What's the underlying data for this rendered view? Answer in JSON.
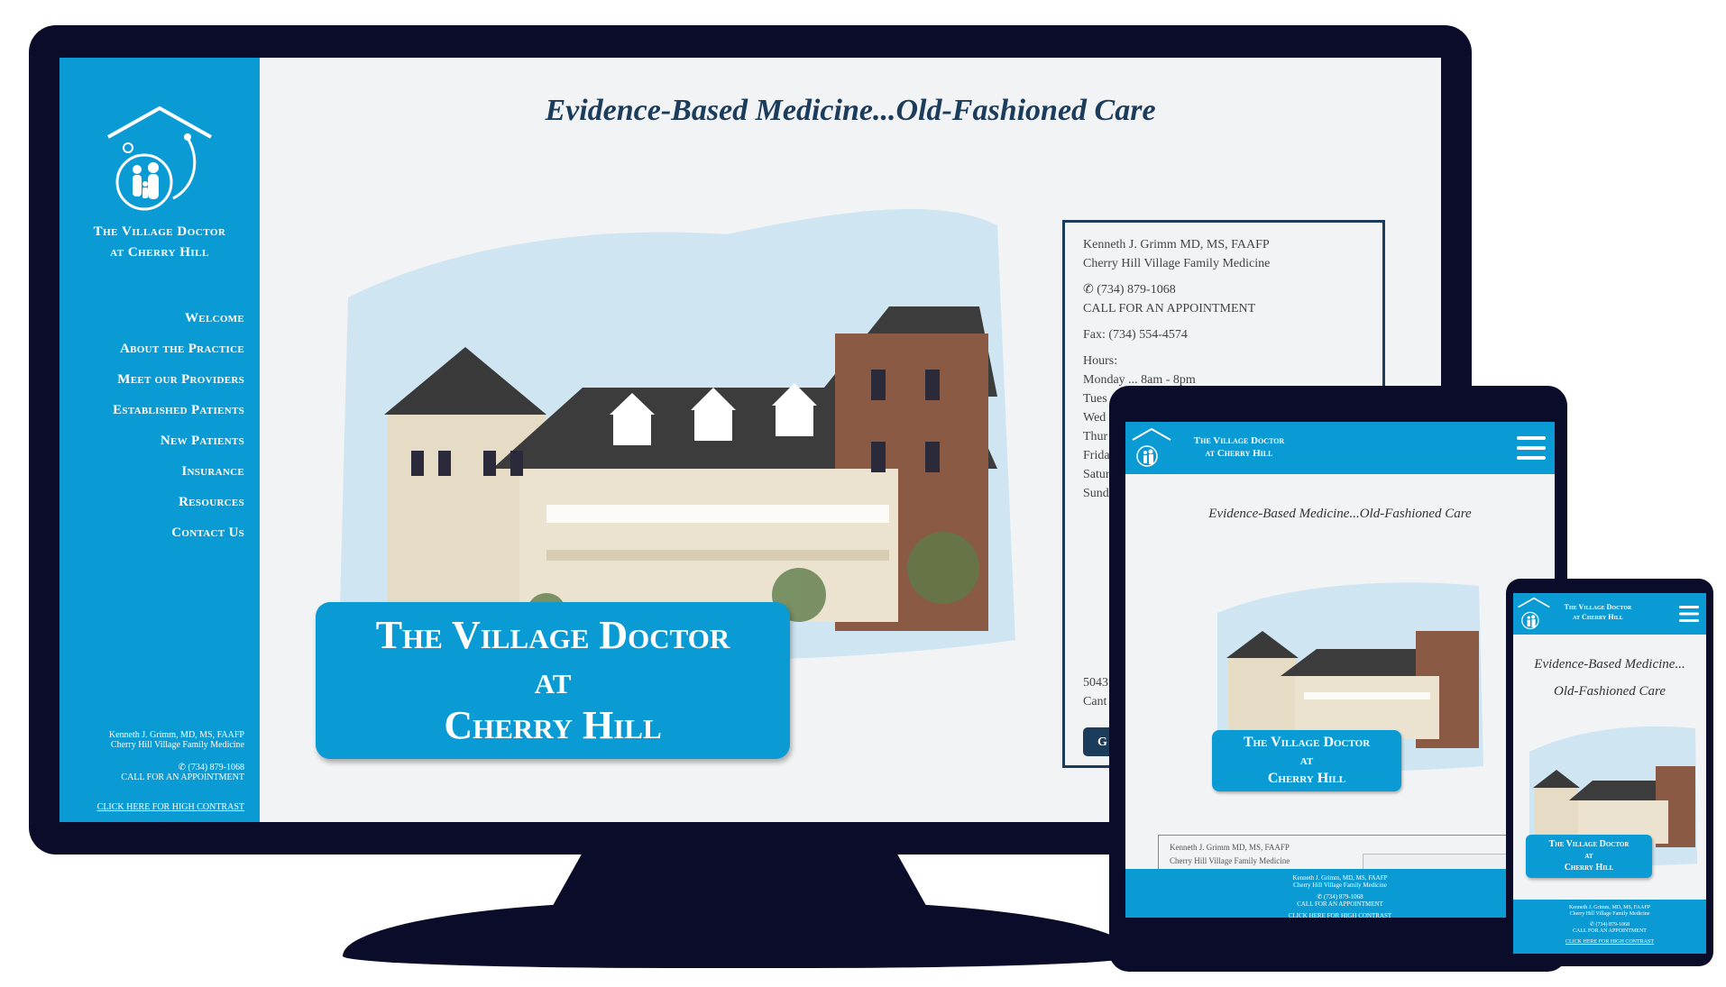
{
  "colors": {
    "brand_blue": "#0a9bd4",
    "navy": "#1c3c5c",
    "device_frame": "#0b0b2a",
    "page_bg": "#f2f3f5"
  },
  "brand": {
    "line1": "The Village Doctor",
    "line2": "at Cherry Hill"
  },
  "tagline": "Evidence-Based Medicine...Old-Fashioned Care",
  "tagline_mobile": {
    "line1": "Evidence-Based Medicine...",
    "line2": "Old-Fashioned Care"
  },
  "banner": {
    "line1": "The Village Doctor",
    "line2": "at",
    "line3": "Cherry Hill"
  },
  "nav": [
    "Welcome",
    "About the Practice",
    "Meet our Providers",
    "Established Patients",
    "New Patients",
    "Insurance",
    "Resources",
    "Contact Us"
  ],
  "footer": {
    "name": "Kenneth J. Grimm, MD, MS, FAAFP",
    "practice": "Cherry Hill Village Family Medicine",
    "phone": "(734) 879-1068",
    "cta": "CALL FOR AN APPOINTMENT",
    "high_contrast": "CLICK HERE FOR HIGH CONTRAST"
  },
  "contact_card": {
    "name": "Kenneth J. Grimm MD, MS, FAAFP",
    "practice": "Cherry Hill Village Family Medicine",
    "phone": "(734) 879-1068",
    "cta": "CALL FOR AN APPOINTMENT",
    "fax": "Fax: (734) 554-4574",
    "hours_label": "Hours:",
    "hours": [
      "Monday ... 8am - 8pm",
      "Tues",
      "Wed",
      "Thur",
      "Frida",
      "Satur",
      "Sund"
    ],
    "address": [
      "5043",
      "Cant"
    ],
    "button": "G"
  },
  "icons": {
    "logo": "house-family-stethoscope-icon",
    "phone": "phone-icon",
    "menu": "hamburger-menu-icon"
  }
}
